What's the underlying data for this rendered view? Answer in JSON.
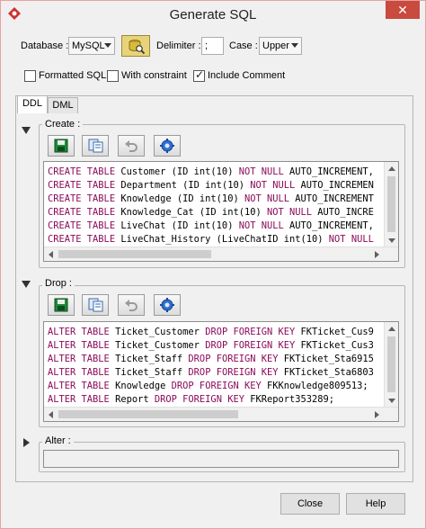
{
  "window": {
    "title": "Generate SQL",
    "close_glyph": "✕"
  },
  "options": {
    "database_label": "Database :",
    "database_value": "MySQL",
    "delimiter_label": "Delimiter :",
    "delimiter_value": ";",
    "case_label": "Case :",
    "case_value": "Upper",
    "formatted_sql_label": "Formatted SQL",
    "formatted_sql_checked": false,
    "with_constraint_label": "With constraint",
    "with_constraint_checked": false,
    "include_comment_label": "Include Comment",
    "include_comment_checked": true
  },
  "tabs": [
    {
      "label": "DDL",
      "active": true
    },
    {
      "label": "DML",
      "active": false
    }
  ],
  "sections": {
    "create": {
      "label": "Create :",
      "expanded": true,
      "lines": [
        [
          "CREATE TABLE",
          " Customer (ID int(10) ",
          "NOT NULL",
          " AUTO_INCREMENT,"
        ],
        [
          "CREATE TABLE",
          " Department (ID int(10) ",
          "NOT NULL",
          " AUTO_INCREMEN"
        ],
        [
          "CREATE TABLE",
          " Knowledge (ID int(10) ",
          "NOT NULL",
          " AUTO_INCREMENT"
        ],
        [
          "CREATE TABLE",
          " Knowledge_Cat (ID int(10) ",
          "NOT NULL",
          " AUTO_INCRE"
        ],
        [
          "CREATE TABLE",
          " LiveChat (ID int(10) ",
          "NOT NULL",
          " AUTO_INCREMENT,"
        ],
        [
          "CREATE TABLE",
          " LiveChat_History (LiveChatID int(10) ",
          "NOT NULL",
          ""
        ]
      ]
    },
    "drop": {
      "label": "Drop :",
      "expanded": true,
      "lines": [
        [
          "ALTER TABLE",
          " Ticket_Customer ",
          "DROP FOREIGN KEY",
          " FKTicket_Cus9"
        ],
        [
          "ALTER TABLE",
          " Ticket_Customer ",
          "DROP FOREIGN KEY",
          " FKTicket_Cus3"
        ],
        [
          "ALTER TABLE",
          " Ticket_Staff ",
          "DROP FOREIGN KEY",
          " FKTicket_Sta6915"
        ],
        [
          "ALTER TABLE",
          " Ticket_Staff ",
          "DROP FOREIGN KEY",
          " FKTicket_Sta6803"
        ],
        [
          "ALTER TABLE",
          " Knowledge ",
          "DROP FOREIGN KEY",
          " FKKnowledge809513;"
        ],
        [
          "ALTER TABLE",
          " Report ",
          "DROP FOREIGN KEY",
          " FKReport353289;"
        ]
      ]
    },
    "alter": {
      "label": "Alter :",
      "expanded": false
    }
  },
  "toolbar_icons": [
    "save-icon",
    "copy-icon",
    "undo-icon",
    "settings-icon"
  ],
  "footer": {
    "close_label": "Close",
    "help_label": "Help"
  },
  "colors": {
    "keyword": "#8b0a5a",
    "close_button": "#c94a3e"
  }
}
